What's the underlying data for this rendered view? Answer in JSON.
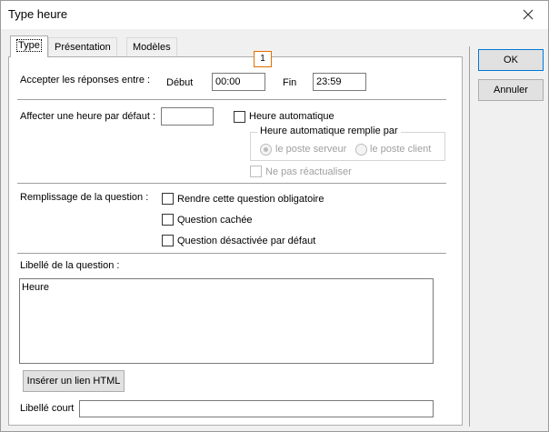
{
  "window": {
    "title": "Type heure",
    "close_icon": "close-icon"
  },
  "tabs": [
    {
      "label": "Type",
      "active": true
    },
    {
      "label": "Présentation",
      "active": false
    },
    {
      "label": "Modèles",
      "active": false
    }
  ],
  "badge": "1",
  "responses": {
    "label": "Accepter les réponses entre :",
    "start_label": "Début",
    "start_value": "00:00",
    "end_label": "Fin",
    "end_value": "23:59"
  },
  "default_time": {
    "label": "Affecter une heure par défaut :",
    "value": "",
    "auto_label": "Heure automatique",
    "auto_checked": false,
    "group_label": "Heure automatique remplie par",
    "radio_server": "le poste serveur",
    "radio_client": "le poste client",
    "no_refresh": "Ne pas réactualiser"
  },
  "filling": {
    "label": "Remplissage de la question :",
    "required": "Rendre cette question obligatoire",
    "hidden": "Question cachée",
    "disabled": "Question désactivée par défaut"
  },
  "question_label": {
    "label": "Libellé de la question :",
    "value": "Heure",
    "insert_link": "Insérer un lien HTML",
    "short_label": "Libellé court",
    "short_value": ""
  },
  "buttons": {
    "ok": "OK",
    "cancel": "Annuler"
  },
  "colors": {
    "focus_border": "#0078d7",
    "badge_border": "#e07000"
  }
}
